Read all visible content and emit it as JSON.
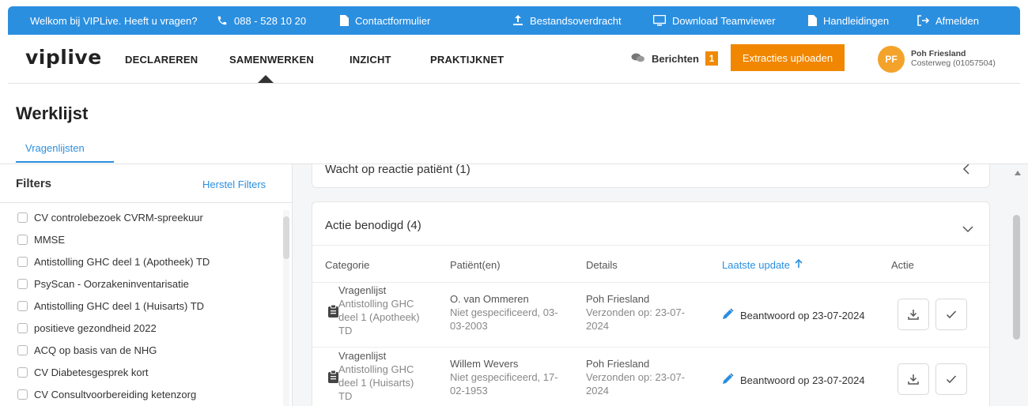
{
  "topbar": {
    "welcome": "Welkom bij VIPLive. Heeft u vragen?",
    "phone": "088 - 528 10 20",
    "contact": "Contactformulier",
    "transfer": "Bestandsoverdracht",
    "teamviewer": "Download Teamviewer",
    "manuals": "Handleidingen",
    "logout": "Afmelden",
    "color": "#2b8fe0"
  },
  "nav": {
    "logo": "viplive",
    "links": [
      "DECLAREREN",
      "SAMENWERKEN",
      "INZICHT",
      "PRAKTIJKNET"
    ],
    "active": "SAMENWERKEN",
    "messages_label": "Berichten",
    "messages_count": "1",
    "upload_label": "Extracties uploaden",
    "accent": "#f18700"
  },
  "user": {
    "initials": "PF",
    "name": "Poh Friesland",
    "org": "Costerweg (01057504)"
  },
  "page": {
    "title": "Werklijst",
    "tab": "Vragenlijsten"
  },
  "sidebar": {
    "title": "Filters",
    "reset": "Herstel Filters",
    "items": [
      "CV controlebezoek CVRM-spreekuur",
      "MMSE",
      "Antistolling GHC deel 1 (Apotheek) TD",
      "PsyScan - Oorzakeninventarisatie",
      "Antistolling GHC deel 1 (Huisarts) TD",
      "positieve gezondheid 2022",
      "ACQ op basis van de NHG",
      "CV Diabetesgesprek kort",
      "CV Consultvoorbereiding ketenzorg"
    ]
  },
  "sections": {
    "waiting": "Wacht op reactie patiënt (1)",
    "action": "Actie benodigd (4)"
  },
  "table": {
    "headers": {
      "category": "Categorie",
      "patient": "Patiënt(en)",
      "details": "Details",
      "updated": "Laatste update",
      "action": "Actie"
    },
    "rows": [
      {
        "cat_type": "Vragenlijst",
        "cat_l1": "Antistolling GHC",
        "cat_l2": "deel 1 (Apotheek)",
        "cat_l3": "TD",
        "patient": "O. van Ommeren",
        "gender_l1": "Niet gespecificeerd, 03-",
        "gender_l2": "03-2003",
        "sender": "Poh Friesland",
        "sent_l1": "Verzonden op: 23-07-",
        "sent_l2": "2024",
        "answer": "Beantwoord op 23-07-2024"
      },
      {
        "cat_type": "Vragenlijst",
        "cat_l1": "Antistolling GHC",
        "cat_l2": "deel 1 (Huisarts)",
        "cat_l3": "TD",
        "patient": "Willem Wevers",
        "gender_l1": "Niet gespecificeerd, 17-",
        "gender_l2": "02-1953",
        "sender": "Poh Friesland",
        "sent_l1": "Verzonden op: 23-07-",
        "sent_l2": "2024",
        "answer": "Beantwoord op 23-07-2024"
      }
    ]
  }
}
